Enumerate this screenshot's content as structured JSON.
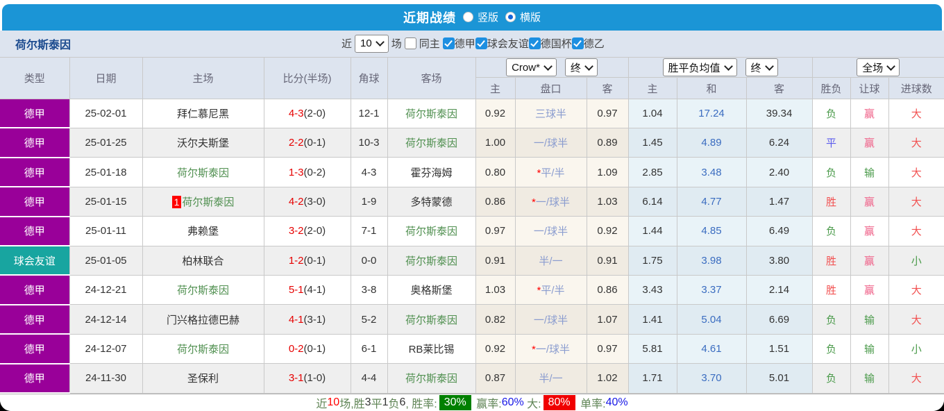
{
  "titlebar": {
    "title": "近期战绩",
    "layout_options": [
      {
        "label": "竖版",
        "selected": false
      },
      {
        "label": "横版",
        "selected": true
      }
    ]
  },
  "filterbar": {
    "team_title": "荷尔斯泰因",
    "recent_label": "近",
    "recent_count": "10",
    "games_label": "场",
    "same_venue": {
      "label": "同主",
      "checked": false
    },
    "leagues": [
      {
        "label": "德甲",
        "checked": true
      },
      {
        "label": "球会友谊",
        "checked": true
      },
      {
        "label": "德国杯",
        "checked": true
      },
      {
        "label": "德乙",
        "checked": true
      }
    ]
  },
  "colors": {
    "titlebar_blue": "#1b95d6",
    "panel_bg": "#dde4ef",
    "league_bundesliga": "#990099",
    "league_friendly": "#18a5a0",
    "self_team_green": "#4f8f4f",
    "score_red": "#e60000",
    "handicap_blue": "#8a9ccf",
    "avg_mid_blue": "#3a6cc0",
    "result_red": "#f25050",
    "result_rose": "#ef5f87",
    "result_green": "#4a9a4a",
    "result_blue": "#5b5bed",
    "win_rate_badge_green": "#008000",
    "big_rate_badge_red": "#f00000"
  },
  "table": {
    "left_headers": [
      "类型",
      "日期",
      "主场",
      "比分(半场)",
      "角球",
      "客场"
    ],
    "sub_headers": [
      "主",
      "盘口",
      "客",
      "主",
      "和",
      "客",
      "胜负",
      "让球",
      "进球数"
    ],
    "groups": {
      "crow_select": "Crow*",
      "crow_stage_select": "终",
      "avg_select": "胜平负均值",
      "avg_stage_select": "终",
      "scope_select": "全场"
    },
    "rows": [
      {
        "type": "德甲",
        "type_color": "#990099",
        "date": "25-02-01",
        "home": "拜仁慕尼黑",
        "home_self": false,
        "home_badge": "",
        "score": "4-3",
        "half": "(2-0)",
        "corner": "12-1",
        "away": "荷尔斯泰因",
        "away_self": true,
        "odds_home": "0.92",
        "handicap": "三球半",
        "handicap_star": false,
        "odds_away": "0.97",
        "avg_home": "1.04",
        "avg_draw": "17.24",
        "avg_away": "39.34",
        "spf": "负",
        "rq": "赢",
        "jq": "大"
      },
      {
        "type": "德甲",
        "type_color": "#990099",
        "date": "25-01-25",
        "home": "沃尔夫斯堡",
        "home_self": false,
        "home_badge": "",
        "score": "2-2",
        "half": "(0-1)",
        "corner": "10-3",
        "away": "荷尔斯泰因",
        "away_self": true,
        "odds_home": "1.00",
        "handicap": "一/球半",
        "handicap_star": false,
        "odds_away": "0.89",
        "avg_home": "1.45",
        "avg_draw": "4.89",
        "avg_away": "6.24",
        "spf": "平",
        "rq": "赢",
        "jq": "大"
      },
      {
        "type": "德甲",
        "type_color": "#990099",
        "date": "25-01-18",
        "home": "荷尔斯泰因",
        "home_self": true,
        "home_badge": "",
        "score": "1-3",
        "half": "(0-2)",
        "corner": "4-3",
        "away": "霍芬海姆",
        "away_self": false,
        "odds_home": "0.80",
        "handicap": "平/半",
        "handicap_star": true,
        "odds_away": "1.09",
        "avg_home": "2.85",
        "avg_draw": "3.48",
        "avg_away": "2.40",
        "spf": "负",
        "rq": "输",
        "jq": "大"
      },
      {
        "type": "德甲",
        "type_color": "#990099",
        "date": "25-01-15",
        "home": "荷尔斯泰因",
        "home_self": true,
        "home_badge": "1",
        "score": "4-2",
        "half": "(3-0)",
        "corner": "1-9",
        "away": "多特蒙德",
        "away_self": false,
        "odds_home": "0.86",
        "handicap": "一/球半",
        "handicap_star": true,
        "odds_away": "1.03",
        "avg_home": "6.14",
        "avg_draw": "4.77",
        "avg_away": "1.47",
        "spf": "胜",
        "rq": "赢",
        "jq": "大"
      },
      {
        "type": "德甲",
        "type_color": "#990099",
        "date": "25-01-11",
        "home": "弗赖堡",
        "home_self": false,
        "home_badge": "",
        "score": "3-2",
        "half": "(2-0)",
        "corner": "7-1",
        "away": "荷尔斯泰因",
        "away_self": true,
        "odds_home": "0.97",
        "handicap": "一/球半",
        "handicap_star": false,
        "odds_away": "0.92",
        "avg_home": "1.44",
        "avg_draw": "4.85",
        "avg_away": "6.49",
        "spf": "负",
        "rq": "赢",
        "jq": "大"
      },
      {
        "type": "球会友谊",
        "type_color": "#18a5a0",
        "date": "25-01-05",
        "home": "柏林联合",
        "home_self": false,
        "home_badge": "",
        "score": "1-2",
        "half": "(0-1)",
        "corner": "0-0",
        "away": "荷尔斯泰因",
        "away_self": true,
        "odds_home": "0.91",
        "handicap": "半/一",
        "handicap_star": false,
        "odds_away": "0.91",
        "avg_home": "1.75",
        "avg_draw": "3.98",
        "avg_away": "3.80",
        "spf": "胜",
        "rq": "赢",
        "jq": "小"
      },
      {
        "type": "德甲",
        "type_color": "#990099",
        "date": "24-12-21",
        "home": "荷尔斯泰因",
        "home_self": true,
        "home_badge": "",
        "score": "5-1",
        "half": "(4-1)",
        "corner": "3-8",
        "away": "奥格斯堡",
        "away_self": false,
        "odds_home": "1.03",
        "handicap": "平/半",
        "handicap_star": true,
        "odds_away": "0.86",
        "avg_home": "3.43",
        "avg_draw": "3.37",
        "avg_away": "2.14",
        "spf": "胜",
        "rq": "赢",
        "jq": "大"
      },
      {
        "type": "德甲",
        "type_color": "#990099",
        "date": "24-12-14",
        "home": "门兴格拉德巴赫",
        "home_self": false,
        "home_badge": "",
        "score": "4-1",
        "half": "(3-1)",
        "corner": "5-2",
        "away": "荷尔斯泰因",
        "away_self": true,
        "odds_home": "0.82",
        "handicap": "一/球半",
        "handicap_star": false,
        "odds_away": "1.07",
        "avg_home": "1.41",
        "avg_draw": "5.04",
        "avg_away": "6.69",
        "spf": "负",
        "rq": "输",
        "jq": "大"
      },
      {
        "type": "德甲",
        "type_color": "#990099",
        "date": "24-12-07",
        "home": "荷尔斯泰因",
        "home_self": true,
        "home_badge": "",
        "score": "0-2",
        "half": "(0-1)",
        "corner": "6-1",
        "away": "RB莱比锡",
        "away_self": false,
        "odds_home": "0.92",
        "handicap": "一/球半",
        "handicap_star": true,
        "odds_away": "0.97",
        "avg_home": "5.81",
        "avg_draw": "4.61",
        "avg_away": "1.51",
        "spf": "负",
        "rq": "输",
        "jq": "小"
      },
      {
        "type": "德甲",
        "type_color": "#990099",
        "date": "24-11-30",
        "home": "圣保利",
        "home_self": false,
        "home_badge": "",
        "score": "3-1",
        "half": "(1-0)",
        "corner": "4-4",
        "away": "荷尔斯泰因",
        "away_self": true,
        "odds_home": "0.87",
        "handicap": "半/一",
        "handicap_star": false,
        "odds_away": "1.02",
        "avg_home": "1.71",
        "avg_draw": "3.70",
        "avg_away": "5.01",
        "spf": "负",
        "rq": "输",
        "jq": "大"
      }
    ]
  },
  "footer": {
    "segments": [
      {
        "text": "近",
        "style": "label"
      },
      {
        "text": "10",
        "style": "red-text"
      },
      {
        "text": "场,胜",
        "style": "label"
      },
      {
        "text": "3",
        "style": "dark"
      },
      {
        "text": "平",
        "style": "label"
      },
      {
        "text": "1",
        "style": "dark"
      },
      {
        "text": "负",
        "style": "label"
      },
      {
        "text": "6",
        "style": "dark"
      },
      {
        "text": ", 胜率:",
        "style": "label"
      },
      {
        "text": "30%",
        "style": "green-badge"
      },
      {
        "text": " 赢率:",
        "style": "label"
      },
      {
        "text": "60%",
        "style": "blue-text"
      },
      {
        "text": " 大:",
        "style": "label"
      },
      {
        "text": "80%",
        "style": "red-badge"
      },
      {
        "text": " 单率:",
        "style": "label"
      },
      {
        "text": "40%",
        "style": "blue-text"
      }
    ]
  }
}
